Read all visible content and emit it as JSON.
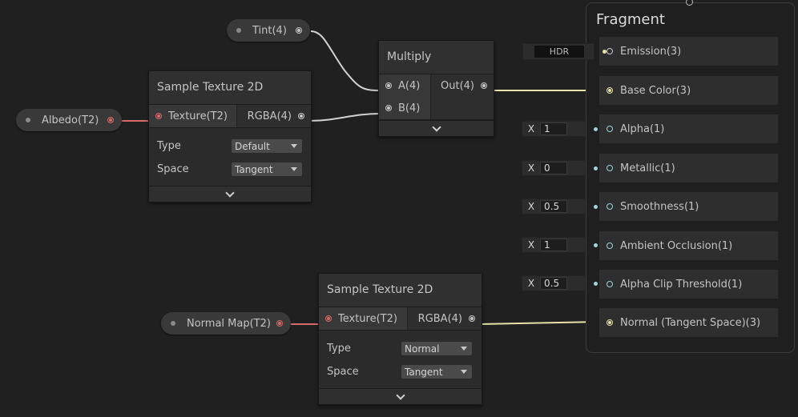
{
  "properties": {
    "tint": "Tint(4)",
    "albedo": "Albedo(T2)",
    "normal_map": "Normal Map(T2)"
  },
  "sample_texture_1": {
    "title": "Sample Texture 2D",
    "input": "Texture(T2)",
    "output": "RGBA(4)",
    "type_label": "Type",
    "type_value": "Default",
    "space_label": "Space",
    "space_value": "Tangent"
  },
  "sample_texture_2": {
    "title": "Sample Texture 2D",
    "input": "Texture(T2)",
    "output": "RGBA(4)",
    "type_label": "Type",
    "type_value": "Normal",
    "space_label": "Space",
    "space_value": "Tangent"
  },
  "multiply": {
    "title": "Multiply",
    "input_a": "A(4)",
    "input_b": "B(4)",
    "output": "Out(4)"
  },
  "fragment": {
    "title": "Fragment",
    "blocks": [
      "Emission(3)",
      "Base Color(3)",
      "Alpha(1)",
      "Metallic(1)",
      "Smoothness(1)",
      "Ambient Occlusion(1)",
      "Alpha Clip Threshold(1)",
      "Normal (Tangent Space)(3)"
    ]
  },
  "inline_inputs": {
    "emission_hdr": "HDR",
    "x_label": "X",
    "alpha": "1",
    "metallic": "0",
    "smoothness": "0.5",
    "ambient_occlusion": "1",
    "alpha_clip": "0.5"
  },
  "colors": {
    "texture_wire": "#d86a6a",
    "vector4_wire": "#d2d2d2",
    "vector3_wire": "#e6e2a8",
    "float_wire": "#9fd4df",
    "background": "#202020"
  }
}
